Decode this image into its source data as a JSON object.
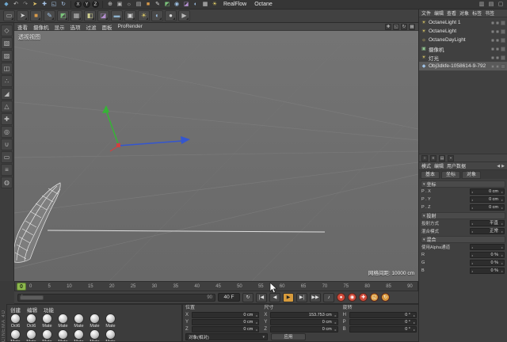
{
  "toolbar1": {
    "icons_left": [
      {
        "name": "c4d-logo",
        "glyph": "◆",
        "color": "#6fa8d0"
      },
      {
        "name": "undo-icon",
        "glyph": "↶",
        "color": "#c8c8c8"
      },
      {
        "name": "redo-icon",
        "glyph": "↷",
        "color": "#8f8f8f"
      },
      {
        "name": "live-selection-icon",
        "glyph": "➤",
        "color": "#e0c36a"
      },
      {
        "name": "move-icon",
        "glyph": "✚",
        "color": "#a8c6e8"
      },
      {
        "name": "scale-icon",
        "glyph": "◱",
        "color": "#a8c6e8"
      },
      {
        "name": "rotate-icon",
        "glyph": "↻",
        "color": "#a8c6e8"
      }
    ],
    "axis_buttons": [
      {
        "name": "axis-x-button",
        "label": "X"
      },
      {
        "name": "axis-y-button",
        "label": "Y"
      },
      {
        "name": "axis-z-button",
        "label": "Z"
      }
    ],
    "icons_mid": [
      {
        "name": "coord-system-icon",
        "glyph": "⊕",
        "color": "#c8c8c8"
      },
      {
        "name": "render-view-icon",
        "glyph": "▣",
        "color": "#b8b8b8"
      },
      {
        "name": "render-settings-icon",
        "glyph": "☼",
        "color": "#b8b8b8"
      },
      {
        "name": "render-queue-icon",
        "glyph": "▤",
        "color": "#b8b8b8"
      },
      {
        "name": "cube-primitive-icon",
        "glyph": "■",
        "color": "#d99b4a"
      },
      {
        "name": "spline-pen-icon",
        "glyph": "✎",
        "color": "#cfcfcf"
      },
      {
        "name": "subdivision-icon",
        "glyph": "◩",
        "color": "#7cc47c"
      },
      {
        "name": "instance-icon",
        "glyph": "◉",
        "color": "#9fc3e8"
      },
      {
        "name": "deformer-icon",
        "glyph": "◪",
        "color": "#b48fd0"
      },
      {
        "name": "environment-icon",
        "glyph": "◐",
        "color": "#9fc3e8"
      },
      {
        "name": "camera-icon",
        "glyph": "▦",
        "color": "#cfcfcf"
      },
      {
        "name": "light-icon",
        "glyph": "☀",
        "color": "#e8d46a"
      }
    ],
    "menus": [
      {
        "name": "menu-realflow",
        "label": "RealFlow"
      },
      {
        "name": "menu-octane",
        "label": "Octane"
      }
    ],
    "icons_right": [
      {
        "name": "layout-icon",
        "glyph": "▥",
        "color": "#b0b0b0"
      },
      {
        "name": "panels-icon",
        "glyph": "▤",
        "color": "#b0b0b0"
      },
      {
        "name": "window-icon",
        "glyph": "▢",
        "color": "#b0b0b0"
      }
    ]
  },
  "toolbar2": {
    "icons": [
      {
        "name": "history-icon",
        "glyph": "▭",
        "color": "#b8b8b8"
      },
      {
        "name": "select-tool-icon",
        "glyph": "➤",
        "color": "#d8d8d8"
      },
      {
        "name": "cube-tool-icon",
        "glyph": "■",
        "color": "#d99b4a"
      },
      {
        "name": "spline-tool-icon",
        "glyph": "✎",
        "color": "#9fc3e8"
      },
      {
        "name": "subdiv-tool-icon",
        "glyph": "◩",
        "color": "#7cc47c"
      },
      {
        "name": "array-tool-icon",
        "glyph": "▦",
        "color": "#b8b8b8"
      },
      {
        "name": "boole-tool-icon",
        "glyph": "◧",
        "color": "#cfcf8f"
      },
      {
        "name": "deform-tool-icon",
        "glyph": "◪",
        "color": "#b48fd0"
      },
      {
        "name": "floor-tool-icon",
        "glyph": "▬",
        "color": "#8fb4d0"
      },
      {
        "name": "camera-tool-icon",
        "glyph": "▣",
        "color": "#cfcfcf"
      },
      {
        "name": "light-tool-icon",
        "glyph": "☀",
        "color": "#e8d46a"
      },
      {
        "name": "sky-tool-icon",
        "glyph": "◐",
        "color": "#9fc3e8"
      },
      {
        "name": "material-tool-icon",
        "glyph": "●",
        "color": "#d8d8d8"
      },
      {
        "name": "render-tool-icon",
        "glyph": "▶",
        "color": "#b8b8b8"
      }
    ]
  },
  "left_toolbar": {
    "brand": "CINEMA 4D",
    "icons": [
      {
        "name": "make-editable-icon",
        "glyph": "◇"
      },
      {
        "name": "model-mode-icon",
        "glyph": "▧"
      },
      {
        "name": "texture-mode-icon",
        "glyph": "▨"
      },
      {
        "name": "workplane-icon",
        "glyph": "◫"
      },
      {
        "name": "points-mode-icon",
        "glyph": "∴"
      },
      {
        "name": "edges-mode-icon",
        "glyph": "◢"
      },
      {
        "name": "polygons-mode-icon",
        "glyph": "△"
      },
      {
        "name": "axis-mode-icon",
        "glyph": "✚"
      },
      {
        "name": "solo-mode-icon",
        "glyph": "◎"
      },
      {
        "name": "snap-icon",
        "glyph": "∪"
      },
      {
        "name": "workplane-lock-icon",
        "glyph": "▭"
      },
      {
        "name": "quantize-icon",
        "glyph": "≡"
      },
      {
        "name": "measure-icon",
        "glyph": "◍"
      }
    ]
  },
  "viewport": {
    "menu": [
      "查看",
      "摄像机",
      "显示",
      "选项",
      "过滤",
      "面板",
      "ProRender"
    ],
    "corner_icons": [
      {
        "name": "pan-view-icon",
        "glyph": "✚"
      },
      {
        "name": "zoom-view-icon",
        "glyph": "◱"
      },
      {
        "name": "rotate-view-icon",
        "glyph": "↻"
      },
      {
        "name": "toggle-view-icon",
        "glyph": "▦"
      }
    ],
    "view_label": "透视视图",
    "grid_spacing_label": "网格间距: 10000 cm"
  },
  "timeline": {
    "current_frame": "0",
    "ticks": [
      "0",
      "5",
      "10",
      "15",
      "20",
      "25",
      "30",
      "35",
      "40",
      "45",
      "50",
      "55",
      "60",
      "65",
      "70",
      "75",
      "80",
      "85",
      "90"
    ]
  },
  "transport": {
    "range_start": "0",
    "range_end": "90",
    "frame_value": "40 F",
    "buttons": [
      {
        "name": "loop-button",
        "glyph": "↻",
        "bg": "#474747",
        "fg": "#dddddd"
      },
      {
        "name": "goto-start-button",
        "glyph": "|◀",
        "bg": "#474747",
        "fg": "#dddddd"
      },
      {
        "name": "prev-frame-button",
        "glyph": "◀",
        "bg": "#474747",
        "fg": "#dddddd"
      },
      {
        "name": "play-button",
        "glyph": "▶",
        "bg": "#d79b3c",
        "fg": "#222222"
      },
      {
        "name": "next-frame-button",
        "glyph": "▶|",
        "bg": "#474747",
        "fg": "#dddddd"
      },
      {
        "name": "goto-end-button",
        "glyph": "▶▶",
        "bg": "#474747",
        "fg": "#dddddd"
      },
      {
        "name": "sound-button",
        "glyph": "♪",
        "bg": "#474747",
        "fg": "#dddddd"
      }
    ],
    "records": [
      {
        "name": "record-keyframe-button",
        "glyph": "●",
        "color": "#d04b3a"
      },
      {
        "name": "autokey-button",
        "glyph": "◉",
        "color": "#d04b3a"
      },
      {
        "name": "record-position-button",
        "glyph": "✚",
        "color": "#d04b3a"
      },
      {
        "name": "record-scale-button",
        "glyph": "◱",
        "color": "#d7973a"
      },
      {
        "name": "record-rotation-button",
        "glyph": "↻",
        "color": "#d7973a"
      }
    ]
  },
  "materials": {
    "menu": [
      "创建",
      "编辑",
      "功能"
    ],
    "row1": [
      {
        "label": "Oct6"
      },
      {
        "label": "Oct6"
      },
      {
        "label": "Mate"
      },
      {
        "label": "Mate"
      },
      {
        "label": "Mate"
      },
      {
        "label": "Mate"
      },
      {
        "label": "Mate"
      }
    ],
    "row2": [
      {
        "label": "Mate"
      },
      {
        "label": "Mate"
      },
      {
        "label": "Mate"
      },
      {
        "label": "Mate"
      },
      {
        "label": "Mate"
      },
      {
        "label": "Mate"
      },
      {
        "label": "Mate"
      }
    ]
  },
  "coordinates": {
    "position": {
      "title": "位置",
      "rows": [
        {
          "axis": "X",
          "value": "0 cm"
        },
        {
          "axis": "Y",
          "value": "0 cm"
        },
        {
          "axis": "Z",
          "value": "0 cm"
        }
      ]
    },
    "size": {
      "title": "尺寸",
      "rows": [
        {
          "axis": "X",
          "value": "153.753 cm"
        },
        {
          "axis": "Y",
          "value": "0 cm"
        },
        {
          "axis": "Z",
          "value": "0 cm"
        }
      ]
    },
    "rotation": {
      "title": "旋转",
      "rows": [
        {
          "axis": "H",
          "value": "0 °"
        },
        {
          "axis": "P",
          "value": "0 °"
        },
        {
          "axis": "B",
          "value": "0 °"
        }
      ]
    },
    "mode_value": "对象(相对)",
    "apply_label": "应用"
  },
  "objects": {
    "menu": [
      "文件",
      "编辑",
      "查看",
      "对象",
      "标签",
      "书签"
    ],
    "items": [
      {
        "name": "OctaneLight 1",
        "glyph": "☀",
        "color": "#e8d46a",
        "bg": ""
      },
      {
        "name": "OctaneLight",
        "glyph": "☀",
        "color": "#e8d46a",
        "bg": ""
      },
      {
        "name": "OctaneDayLight",
        "glyph": "☼",
        "color": "#e8d46a",
        "bg": ""
      },
      {
        "name": "摄像机",
        "glyph": "▣",
        "color": "#8fc48f",
        "bg": ""
      },
      {
        "name": "灯光",
        "glyph": "☀",
        "color": "#e8d46a",
        "bg": ""
      },
      {
        "name": "Obj3dkfe-1058614-9-792",
        "glyph": "◆",
        "color": "#9fc3e8",
        "bg": "#5a5a5a"
      }
    ]
  },
  "om_toolbar": {
    "icons": [
      {
        "name": "search-icon",
        "glyph": "○"
      },
      {
        "name": "filter-icon",
        "glyph": "≡"
      },
      {
        "name": "layer-icon",
        "glyph": "▤"
      },
      {
        "name": "lock-icon",
        "glyph": "▪"
      }
    ]
  },
  "attributes": {
    "menu": [
      "模式",
      "编辑",
      "用户数据"
    ],
    "nav": [
      {
        "name": "attr-back-icon",
        "glyph": "◀"
      },
      {
        "name": "attr-forward-icon",
        "glyph": "▶"
      }
    ],
    "tabs": [
      "基本",
      "坐标",
      "对象"
    ],
    "section_coord": {
      "title": "坐标",
      "rows": [
        {
          "label": "P . X",
          "value": "0 cm"
        },
        {
          "label": "P . Y",
          "value": "0 cm"
        },
        {
          "label": "P . Z",
          "value": "0 cm"
        }
      ]
    },
    "section_projection": {
      "title": "投射",
      "rows": [
        {
          "label": "投射方式",
          "value": "平直"
        },
        {
          "label": "混合模式",
          "value": "正常"
        }
      ]
    },
    "section_blend": {
      "title": "混合",
      "rows": [
        {
          "label": "使用Alpha通道",
          "value": ""
        },
        {
          "label": "R",
          "value": "0 %"
        },
        {
          "label": "G",
          "value": "0 %"
        },
        {
          "label": "B",
          "value": "0 %"
        }
      ]
    }
  }
}
